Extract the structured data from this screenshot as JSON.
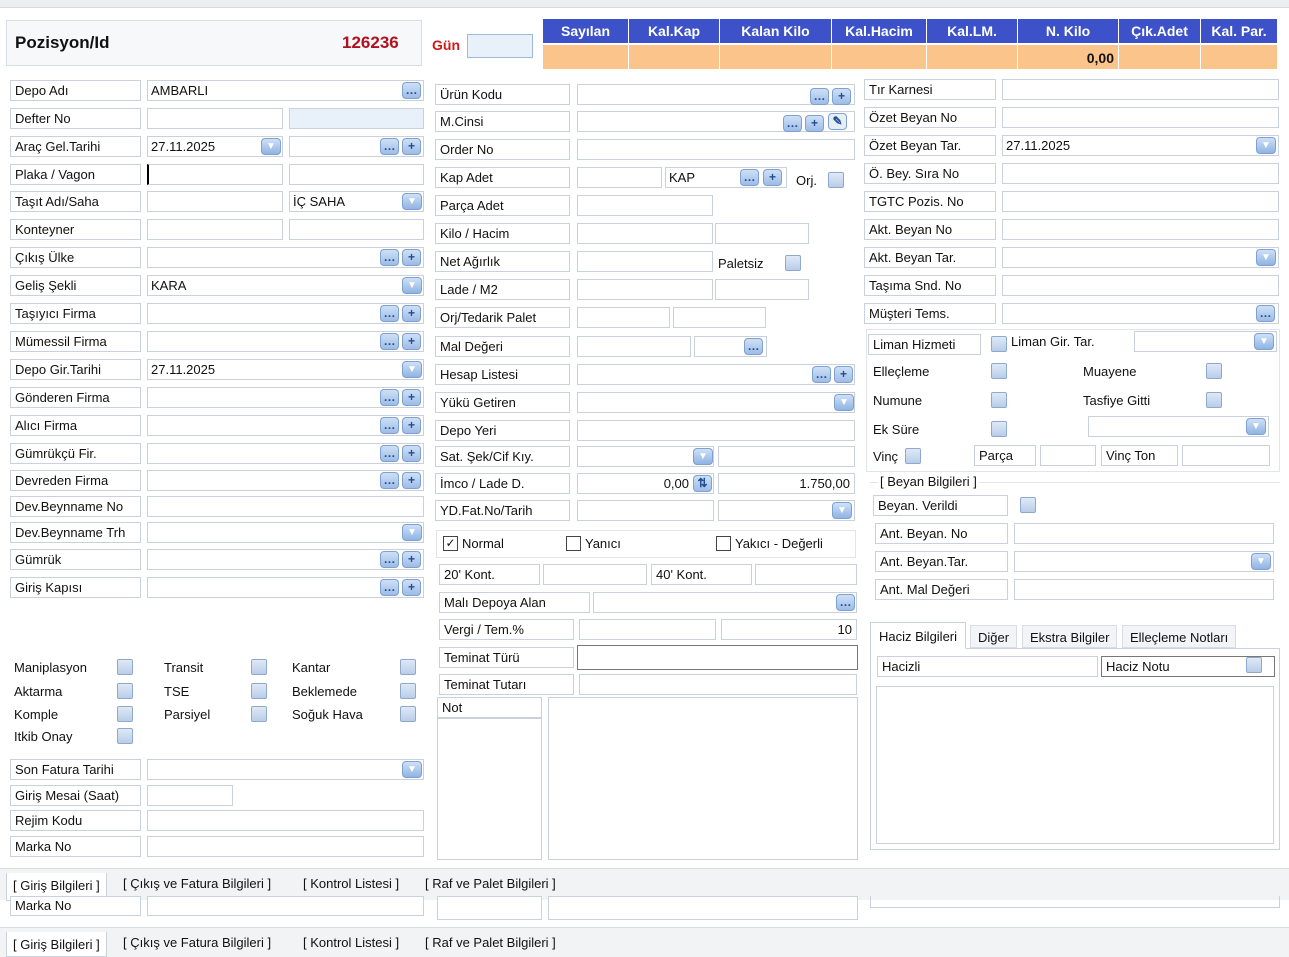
{
  "header": {
    "title": "Pozisyon/Id",
    "id": "126236",
    "gun_label": "Gün",
    "gun_value": "",
    "columns": [
      {
        "label": "Sayılan",
        "value": ""
      },
      {
        "label": "Kal.Kap",
        "value": ""
      },
      {
        "label": "Kalan Kilo",
        "value": ""
      },
      {
        "label": "Kal.Hacim",
        "value": ""
      },
      {
        "label": "Kal.LM.",
        "value": ""
      },
      {
        "label": "N. Kilo",
        "value": "0,00"
      },
      {
        "label": "Çık.Adet",
        "value": ""
      },
      {
        "label": "Kal. Par.",
        "value": ""
      }
    ]
  },
  "left": {
    "depo_adi": {
      "label": "Depo Adı",
      "value": "AMBARLI"
    },
    "defter_no": {
      "label": "Defter No",
      "value": ""
    },
    "arac_gel_tarihi": {
      "label": "Araç Gel.Tarihi",
      "value": "27.11.2025"
    },
    "plaka": {
      "label": "Plaka / Vagon",
      "value": ""
    },
    "tasit_adi": {
      "label": "Taşıt Adı/Saha",
      "value": "",
      "saha": "İÇ SAHA"
    },
    "konteyner": {
      "label": "Konteyner"
    },
    "cikis_ulke": {
      "label": "Çıkış Ülke"
    },
    "gelis_sekli": {
      "label": "Geliş Şekli",
      "value": "KARA"
    },
    "tasiyici_firma": {
      "label": "Taşıyıcı Firma"
    },
    "mumessil_firma": {
      "label": "Mümessil Firma"
    },
    "depo_gir_tarihi": {
      "label": "Depo Gir.Tarihi",
      "value": "27.11.2025"
    },
    "gonderen_firma": {
      "label": "Gönderen Firma"
    },
    "alici_firma": {
      "label": "Alıcı Firma"
    },
    "gumrukcu_fir": {
      "label": "Gümrükçü Fir."
    },
    "devreden_firma": {
      "label": "Devreden Firma"
    },
    "dev_beyanname_no": {
      "label": "Dev.Beynname No"
    },
    "dev_beyanname_trh": {
      "label": "Dev.Beynname Trh"
    },
    "gumruk": {
      "label": "Gümrük"
    },
    "giris_kapisi": {
      "label": "Giriş Kapısı"
    },
    "flags": [
      [
        "Maniplasyon",
        "Transit",
        "Kantar"
      ],
      [
        "Aktarma",
        "TSE",
        "Beklemede"
      ],
      [
        "Komple",
        "Parsiyel",
        "Soğuk Hava"
      ],
      [
        "Itkib Onay"
      ]
    ],
    "son_fatura_tarihi": "Son Fatura Tarihi",
    "giris_mesai": "Giriş Mesai (Saat)",
    "rejim_kodu": "Rejim Kodu",
    "marka_no": "Marka No"
  },
  "middle": {
    "urun_kodu": "Ürün Kodu",
    "m_cinsi": "M.Cinsi",
    "order_no": "Order No",
    "kap_adet": {
      "label": "Kap Adet",
      "unit": "KAP",
      "orj": "Orj."
    },
    "parca_adet": "Parça Adet",
    "kilo_hacim": "Kilo / Hacim",
    "net_agirlik": {
      "label": "Net Ağırlık",
      "paletsiz": "Paletsiz"
    },
    "lade_m2": "Lade / M2",
    "orj_tedarik_palet": "Orj/Tedarik Palet",
    "mal_degeri": "Mal Değeri",
    "hesap_listesi": "Hesap Listesi",
    "yuku_getiren": "Yükü Getiren",
    "depo_yeri": "Depo Yeri",
    "sat_sek": "Sat. Şek/Cif Kıy.",
    "imco": {
      "label": "İmco / Lade D.",
      "v1": "0,00",
      "v2": "1.750,00"
    },
    "yd_fat": "YD.Fat.No/Tarih",
    "radio_normal": "Normal",
    "radio_yanici": "Yanıcı",
    "radio_yakici": "Yakıcı - Değerli",
    "kont20": "20' Kont.",
    "kont40": "40' Kont.",
    "mali_depoya_alan": "Malı Depoya Alan",
    "vergi": {
      "label": "Vergi / Tem.%",
      "value": "10"
    },
    "teminat_turu": "Teminat Türü",
    "teminat_tutari": "Teminat Tutarı",
    "not": "Not"
  },
  "right": {
    "tir_karnesi": "Tır Karnesi",
    "ozet_beyan_no": "Özet Beyan No",
    "ozet_beyan_tar": {
      "label": "Özet Beyan Tar.",
      "value": "27.11.2025"
    },
    "o_bey_sira_no": "Ö. Bey. Sıra No",
    "tgtc_pozis_no": "TGTC Pozis. No",
    "akt_beyan_no": "Akt. Beyan No",
    "akt_beyan_tar": "Akt. Beyan Tar.",
    "tasima_snd_no": "Taşıma Snd. No",
    "musteri_tems": "Müşteri Tems.",
    "liman_hizmeti": "Liman Hizmeti",
    "liman_gir_tar": "Liman Gir. Tar.",
    "ellecleme": "Elleçleme",
    "muayene": "Muayene",
    "numune": "Numune",
    "tasfiye_gitti": "Tasfiye Gitti",
    "ek_sure": "Ek Süre",
    "vinc": "Vinç",
    "parca": "Parça",
    "vinc_ton": "Vinç Ton",
    "beyan_bilgileri": "[ Beyan Bilgileri ]",
    "beyan_verildi": "Beyan. Verildi",
    "ant_beyan_no": "Ant. Beyan. No",
    "ant_beyan_tar": "Ant. Beyan.Tar.",
    "ant_mal_degeri": "Ant. Mal Değeri",
    "tabs": [
      "Haciz Bilgileri",
      "Diğer",
      "Ekstra Bilgiler",
      "Elleçleme Notları"
    ],
    "hacizli": "Hacizli",
    "haciz_notu": "Haciz Notu"
  },
  "bottom_tabs": [
    "[ Giriş Bilgileri ]",
    "[ Çıkış ve Fatura Bilgileri ]",
    "[ Kontrol Listesi ]",
    "[ Raf ve Palet Bilgileri ]"
  ],
  "ghost": {
    "marka_no": "Marka No"
  }
}
